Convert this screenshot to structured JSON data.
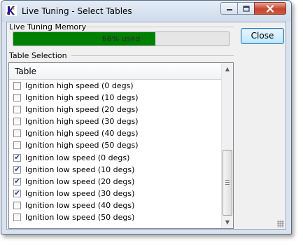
{
  "window": {
    "title": "Live Tuning - Select Tables",
    "app_icon": "app-logo-icon",
    "controls": [
      "minimize-icon",
      "maximize-icon",
      "close-icon"
    ],
    "close_accent": "#c6452f"
  },
  "memory": {
    "label": "Live Tuning Memory",
    "progress_text": "66% used",
    "used_percent": 66,
    "fill_color": "#008000"
  },
  "close_button": {
    "label": "Close"
  },
  "selection": {
    "label": "Table Selection",
    "column_header": "Table",
    "rows": [
      {
        "label": "Ignition high speed (0 degs)",
        "checked": false
      },
      {
        "label": "Ignition high speed (10 degs)",
        "checked": false
      },
      {
        "label": "Ignition high speed (20 degs)",
        "checked": false
      },
      {
        "label": "Ignition high speed (30 degs)",
        "checked": false
      },
      {
        "label": "Ignition high speed (40 degs)",
        "checked": false
      },
      {
        "label": "Ignition high speed (50 degs)",
        "checked": false
      },
      {
        "label": "Ignition low speed (0 degs)",
        "checked": true
      },
      {
        "label": "Ignition low speed (10 degs)",
        "checked": true
      },
      {
        "label": "Ignition low speed (20 degs)",
        "checked": true
      },
      {
        "label": "Ignition low speed (30 degs)",
        "checked": true
      },
      {
        "label": "Ignition low speed (40 degs)",
        "checked": false
      },
      {
        "label": "Ignition low speed (50 degs)",
        "checked": false
      }
    ]
  }
}
